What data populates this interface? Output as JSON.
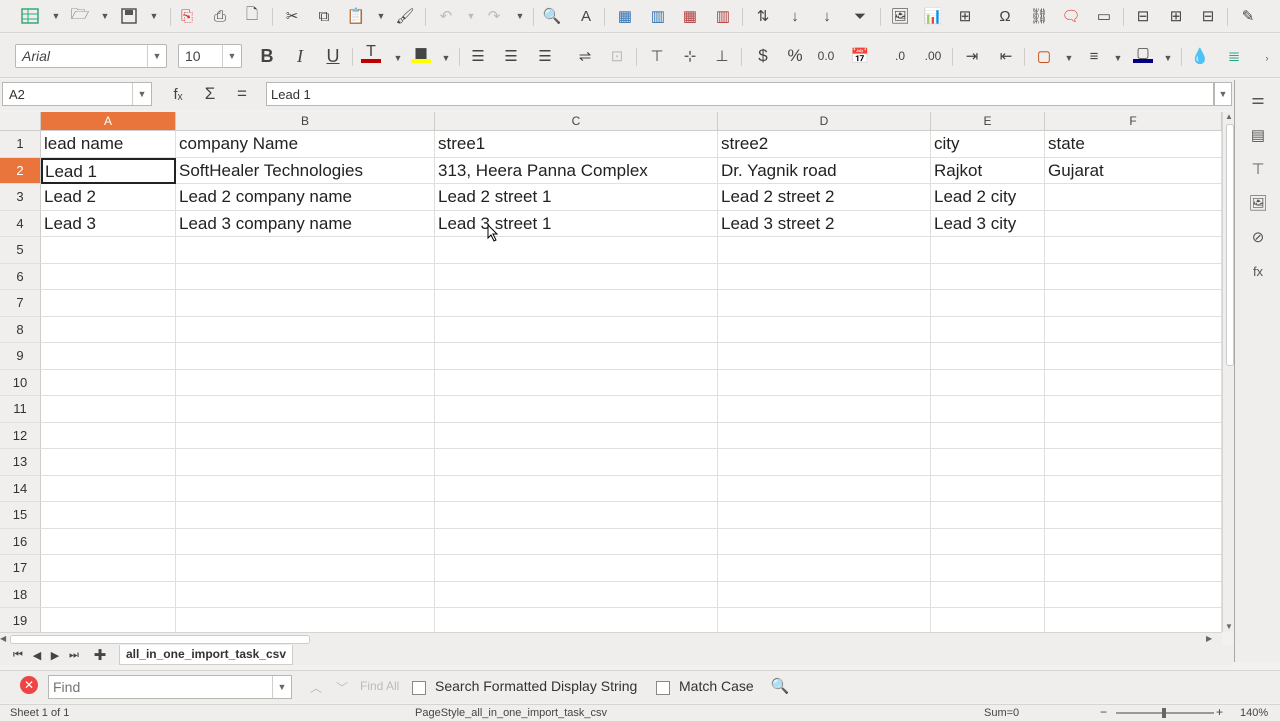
{
  "toolbar1": {
    "icons": [
      "new-spreadsheet",
      "open",
      "save",
      "export-pdf",
      "print",
      "print-preview",
      "cut",
      "copy",
      "paste",
      "clone-formatting",
      "undo",
      "redo",
      "find-replace",
      "spelling",
      "rows",
      "columns",
      "insert-rows",
      "insert-columns",
      "sort-ascending",
      "sort",
      "sort-descending",
      "autofilter",
      "insert-image",
      "insert-chart",
      "pivot-table",
      "special-character",
      "hyperlink",
      "comment",
      "headers-footers",
      "define-print-area",
      "freeze-rows",
      "split-window",
      "show-draw"
    ]
  },
  "toolbar2": {
    "font_name": "Arial",
    "font_size": "10",
    "bold": "B",
    "italic": "I",
    "underline": "U",
    "currency": "$",
    "percent": "%",
    "number": "0.0",
    "font_color": "#c00000",
    "highlight_color": "#ffff00",
    "border_color": "#000080"
  },
  "formula_bar": {
    "name_box": "A2",
    "function_wizard": "fₓ",
    "sum": "Σ",
    "equals": "=",
    "content": "Lead 1"
  },
  "grid": {
    "columns": [
      "A",
      "B",
      "C",
      "D",
      "E",
      "F"
    ],
    "rows": [
      "1",
      "2",
      "3",
      "4",
      "5",
      "6",
      "7",
      "8",
      "9",
      "10",
      "11",
      "12",
      "13",
      "14",
      "15",
      "16",
      "17",
      "18",
      "19"
    ],
    "selected_column": "A",
    "selected_row": "2",
    "data": [
      [
        "lead name",
        "company Name",
        "stree1",
        "stree2",
        "city",
        "state"
      ],
      [
        "Lead 1",
        "SoftHealer Technologies",
        "313, Heera Panna Complex",
        "Dr. Yagnik road",
        "Rajkot",
        "Gujarat"
      ],
      [
        "Lead 2",
        "Lead 2 company name",
        "Lead 2 street 1",
        "Lead 2 street 2",
        "Lead 2 city",
        ""
      ],
      [
        "Lead 3",
        "Lead 3 company name",
        "Lead 3 street 1",
        "Lead 3 street 2",
        "Lead 3 city",
        ""
      ]
    ]
  },
  "sheet_tabs": {
    "active_tab": "all_in_one_import_task_csv"
  },
  "find_bar": {
    "placeholder": "Find",
    "find_all": "Find All",
    "search_formatted": "Search Formatted Display String",
    "match_case": "Match Case"
  },
  "status_bar": {
    "sheet": "Sheet 1 of 1",
    "page_style": "PageStyle_all_in_one_import_task_csv",
    "sum": "Sum=0",
    "zoom": "140%"
  },
  "accent": "#e9743c"
}
